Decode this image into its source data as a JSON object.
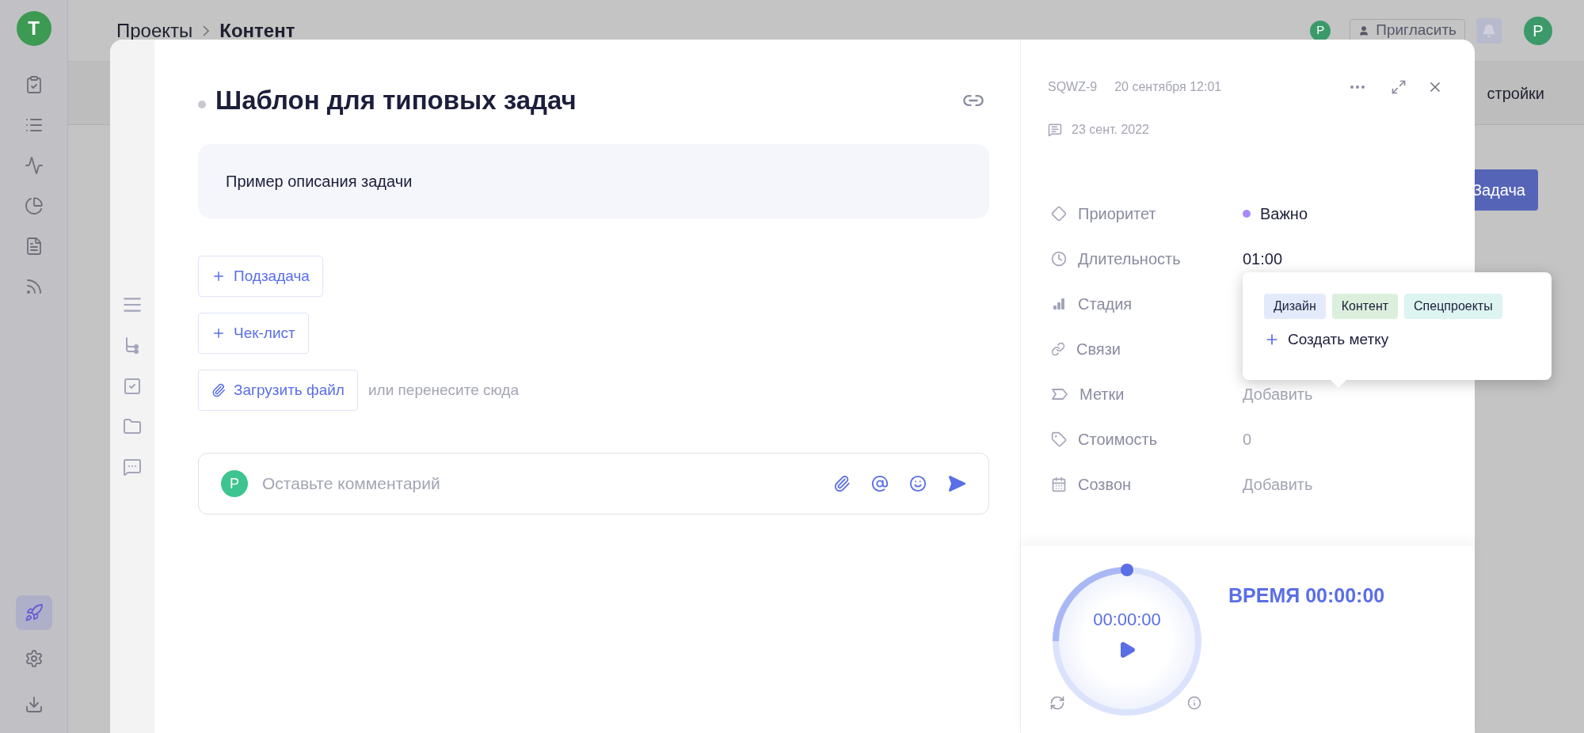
{
  "app_sidebar": {
    "avatar": "T",
    "items": [
      {
        "selected": false
      },
      {
        "selected": false
      },
      {
        "selected": false
      },
      {
        "selected": false
      },
      {
        "selected": false
      },
      {
        "selected": false
      },
      {
        "selected": true
      },
      {
        "selected": false
      },
      {
        "selected": false
      }
    ]
  },
  "header": {
    "breadcrumb": [
      {
        "label": "Проекты",
        "current": false
      },
      {
        "label": "Контент",
        "current": true
      }
    ],
    "member_avatar": "P",
    "invite_button": "Пригласить",
    "user_avatar": "P"
  },
  "background": {
    "settings_tab": "стройки",
    "task_button": "Задача"
  },
  "task": {
    "title": "Шаблон для типовых задач",
    "description": "Пример описания задачи",
    "actions": [
      {
        "kind": "add",
        "label": "Подзадача"
      },
      {
        "kind": "add",
        "label": "Чек-лист"
      },
      {
        "kind": "upload",
        "label": "Загрузить файл"
      }
    ],
    "drop_hint": "или перенесите сюда",
    "comment": {
      "avatar": "P",
      "placeholder": "Оставьте комментарий"
    }
  },
  "details": {
    "id": "SQWZ-9",
    "created": "20 сентября 12:01",
    "comment_date": "23 сент. 2022",
    "properties": [
      {
        "kind": "priority",
        "label": "Приоритет",
        "value": "Важно",
        "muted": false,
        "color": "#a78bfa"
      },
      {
        "kind": "duration",
        "label": "Длительность",
        "value": "01:00",
        "muted": false
      },
      {
        "kind": "stage",
        "label": "Стадия"
      },
      {
        "kind": "links",
        "label": "Связи"
      },
      {
        "kind": "tags",
        "label": "Метки",
        "value": "Добавить",
        "muted": true
      },
      {
        "kind": "cost",
        "label": "Стоимость",
        "value": "0",
        "muted": true
      },
      {
        "kind": "call",
        "label": "Созвон",
        "value": "Добавить",
        "muted": true
      }
    ]
  },
  "tag_popup": {
    "tags": [
      {
        "label": "Дизайн",
        "color": "#e3ebfb"
      },
      {
        "label": "Контент",
        "color": "#dcefdc"
      },
      {
        "label": "Спецпроекты",
        "color": "#ddf4f1"
      }
    ],
    "create_label": "Создать метку"
  },
  "timer": {
    "display": "00:00:00",
    "title": "ВРЕМЯ 00:00:00"
  }
}
